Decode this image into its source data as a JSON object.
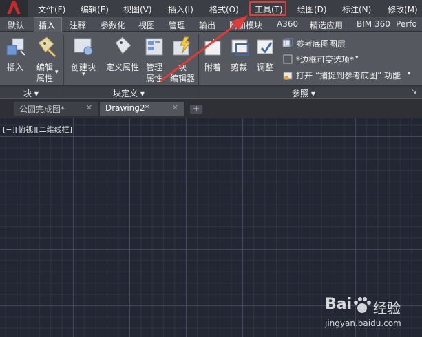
{
  "menu": {
    "items": [
      "文件(F)",
      "编辑(E)",
      "视图(V)",
      "插入(I)",
      "格式(O)",
      "工具(T)",
      "绘图(D)",
      "标注(N)",
      "修改(M)"
    ]
  },
  "ribbon_tabs": [
    "默认",
    "插入",
    "注释",
    "参数化",
    "视图",
    "管理",
    "输出",
    "附加模块",
    "A360",
    "精选应用",
    "BIM 360",
    "Perfo"
  ],
  "ribbon": {
    "block_panel": {
      "insert_label": "插入",
      "edit_attr_line1": "编辑",
      "edit_attr_line2": "属性",
      "title": "块 ▾"
    },
    "block_def_panel": {
      "create_block_label": "创建块",
      "define_attr_label": "定义属性",
      "manage_attr_line1": "管理",
      "manage_attr_line2": "属性",
      "block_editor_line1": "块",
      "block_editor_line2": "编辑器",
      "title": "块定义 ▾"
    },
    "reference_panel": {
      "attach_label": "附着",
      "clip_label": "剪裁",
      "adjust_label": "调整",
      "underlay_layers": "参考底图图层",
      "frame_option": "*边框可变选项*",
      "snap_option": "打开 “捕捉到参考底图” 功能",
      "title": "参照 ▾"
    }
  },
  "doc_tabs": {
    "tab1": "公园完成图*",
    "tab2": "Drawing2*",
    "close": "✕",
    "add": "+"
  },
  "viewport": {
    "label": "[−][俯视][二维线框]"
  },
  "watermark": {
    "brand_a": "Bai",
    "brand_b": "经验",
    "url": "jingyan.baidu.com"
  },
  "colors": {
    "highlight": "#e03a3a",
    "canvas": "#222733",
    "ribbon": "#55585f"
  }
}
